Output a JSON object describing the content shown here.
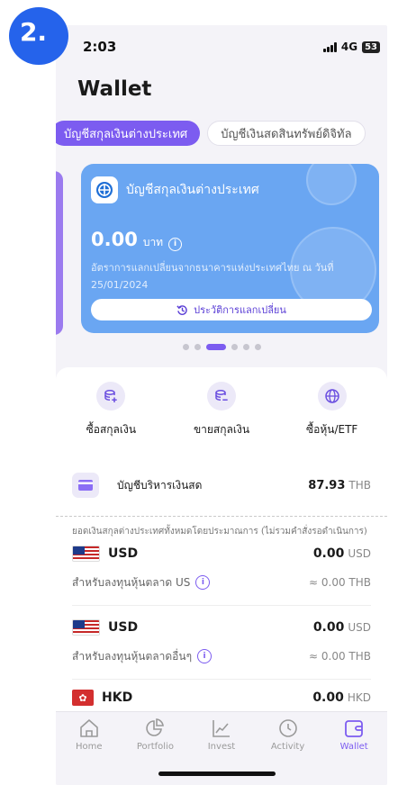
{
  "step_badge": "2.",
  "status": {
    "time": "2:03",
    "network": "4G",
    "battery": "53"
  },
  "page_title": "Wallet",
  "tabs": [
    {
      "label": "บัญชีสกุลเงินต่างประเทศ"
    },
    {
      "label": "บัญชีเงินสดสินทรัพย์ดิจิทัล"
    }
  ],
  "card": {
    "title": "บัญชีสกุลเงินต่างประเทศ",
    "amount": "0.00",
    "unit": "บาท",
    "note": "อัตราการแลกเปลี่ยนจากธนาคารแห่งประเทศไทย ณ วันที่ 25/01/2024",
    "button": "ประวัติการแลกเปลี่ยน",
    "color": "#6aa6f2"
  },
  "actions": [
    {
      "label": "ซื้อสกุลเงิน",
      "icon": "buy-currency-icon"
    },
    {
      "label": "ขายสกุลเงิน",
      "icon": "sell-currency-icon"
    },
    {
      "label": "ซื้อหุ้น/ETF",
      "icon": "globe-icon"
    }
  ],
  "cash_account": {
    "label": "บัญชีบริหารเงินสด",
    "value": "87.93",
    "unit": "THB"
  },
  "total_note": "ยอดเงินสกุลต่างประเทศทั้งหมดโดยประมาณการ (ไม่รวมคำสั่งรอดำเนินการ)",
  "currencies": [
    {
      "code": "USD",
      "amount": "0.00",
      "unit": "USD",
      "sub": "สำหรับลงทุนหุ้นตลาด US",
      "thb": "≈ 0.00 THB"
    },
    {
      "code": "USD",
      "amount": "0.00",
      "unit": "USD",
      "sub": "สำหรับลงทุนหุ้นตลาดอื่นๆ",
      "thb": "≈ 0.00 THB"
    },
    {
      "code": "HKD",
      "amount": "0.00",
      "unit": "HKD"
    }
  ],
  "tabbar": [
    {
      "label": "Home",
      "icon": "home-icon"
    },
    {
      "label": "Portfolio",
      "icon": "pie-chart-icon"
    },
    {
      "label": "Invest",
      "icon": "line-chart-icon"
    },
    {
      "label": "Activity",
      "icon": "clock-icon"
    },
    {
      "label": "Wallet",
      "icon": "wallet-icon",
      "active": true
    }
  ],
  "colors": {
    "accent": "#7c5cf0",
    "badge": "#2563eb"
  }
}
